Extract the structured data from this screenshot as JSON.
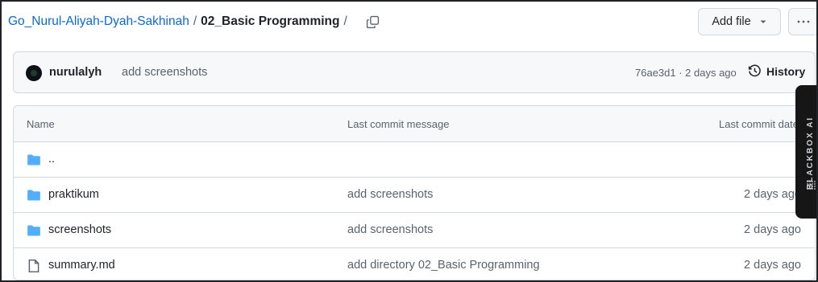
{
  "breadcrumb": {
    "repo": "Go_Nurul-Aliyah-Dyah-Sakhinah",
    "separator": "/",
    "folder": "02_Basic Programming",
    "trailing_separator": "/"
  },
  "toolbar": {
    "add_file_label": "Add file",
    "more_label": "···"
  },
  "commit": {
    "author": "nurulalyh",
    "message": "add screenshots",
    "meta": "76ae3d1 · 2 days ago",
    "history_label": "History"
  },
  "table": {
    "headers": {
      "name": "Name",
      "message": "Last commit message",
      "date": "Last commit date"
    },
    "rows": [
      {
        "type": "folder",
        "name": "..",
        "message": "",
        "date": ""
      },
      {
        "type": "folder",
        "name": "praktikum",
        "message": "add screenshots",
        "date": "2 days ago"
      },
      {
        "type": "folder",
        "name": "screenshots",
        "message": "add screenshots",
        "date": "2 days ago"
      },
      {
        "type": "file",
        "name": "summary.md",
        "message": "add directory 02_Basic Programming",
        "date": "2 days ago"
      }
    ]
  },
  "blackbox": {
    "label": "BLACKBOX AI"
  },
  "colors": {
    "link": "#0969da",
    "folder": "#54aeff",
    "muted": "#59636e",
    "border": "#d1d9e0"
  }
}
